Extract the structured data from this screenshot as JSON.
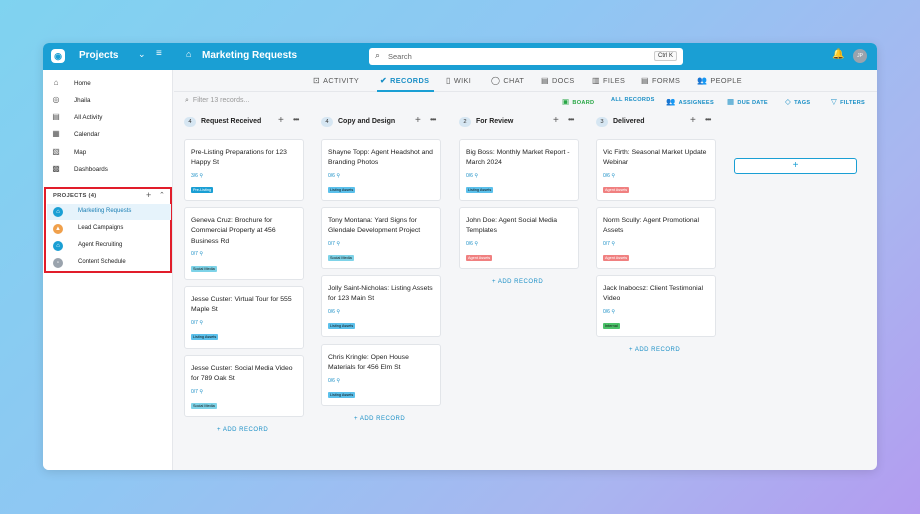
{
  "header": {
    "project_title": "Projects",
    "page_title": "Marketing Requests",
    "search_placeholder": "Search",
    "search_shortcut": "Ctrl K",
    "avatar_initials": "JP"
  },
  "sidebar": {
    "nav": [
      {
        "label": "Home",
        "icon": "home-icon"
      },
      {
        "label": "Jhaila",
        "icon": "check-circle-icon"
      },
      {
        "label": "All Activity",
        "icon": "activity-icon"
      },
      {
        "label": "Calendar",
        "icon": "calendar-icon"
      },
      {
        "label": "Map",
        "icon": "map-icon"
      },
      {
        "label": "Dashboards",
        "icon": "dashboard-icon"
      }
    ],
    "projects_header": "PROJECTS (4)",
    "projects": [
      {
        "label": "Marketing Requests",
        "color": "#1a9fd4",
        "active": true
      },
      {
        "label": "Lead Campaigns",
        "color": "#f0a04b"
      },
      {
        "label": "Agent Recruiting",
        "color": "#1a9fd4"
      },
      {
        "label": "Content Schedule",
        "color": "#9aa3ad"
      }
    ]
  },
  "tabs": [
    {
      "label": "ACTIVITY",
      "icon": "activity-icon"
    },
    {
      "label": "RECORDS",
      "icon": "check-circle-icon",
      "active": true
    },
    {
      "label": "WIKI",
      "icon": "document-icon"
    },
    {
      "label": "CHAT",
      "icon": "chat-icon"
    },
    {
      "label": "DOCS",
      "icon": "docs-icon"
    },
    {
      "label": "FILES",
      "icon": "files-icon"
    },
    {
      "label": "FORMS",
      "icon": "forms-icon"
    },
    {
      "label": "PEOPLE",
      "icon": "people-icon"
    }
  ],
  "toolbar": {
    "filter_placeholder": "Filter 13 records...",
    "board": "BOARD",
    "all_records": "ALL RECORDS",
    "assignees": "ASSIGNEES",
    "due_date": "DUE DATE",
    "tags": "TAGS",
    "filters": "FILTERS"
  },
  "add_record_label": "+ ADD RECORD",
  "colors": {
    "brand": "#1a9fd4",
    "tag_pre_listing": "#1a9fd4",
    "tag_listing_assets": "#5bc0eb",
    "tag_social_media": "#7ed3e8",
    "tag_agent_assets": "#f08080",
    "tag_internal": "#4cc26a"
  },
  "columns": [
    {
      "count": "4",
      "title": "Request Received",
      "cards": [
        {
          "title": "Pre-Listing Preparations for 123 Happy St",
          "progress": "3/6",
          "tag": "Pre-Listing",
          "tag_color": "#1a9fd4"
        },
        {
          "title": "Geneva Cruz: Brochure for Commercial Property at 456 Business Rd",
          "progress": "0/7",
          "tag": "Social Media",
          "tag_color": "#7ed3e8"
        },
        {
          "title": "Jesse Custer: Virtual Tour for 555 Maple St",
          "progress": "0/7",
          "tag": "Listing Assets",
          "tag_color": "#5bc0eb"
        },
        {
          "title": "Jesse Custer: Social Media Video for 789 Oak St",
          "progress": "0/7",
          "tag": "Social Media",
          "tag_color": "#7ed3e8"
        }
      ]
    },
    {
      "count": "4",
      "title": "Copy and Design",
      "cards": [
        {
          "title": "Shayne Topp: Agent Headshot and Branding Photos",
          "progress": "0/6",
          "tag": "Listing Assets",
          "tag_color": "#5bc0eb"
        },
        {
          "title": "Tony Montana: Yard Signs for Glendale Development Project",
          "progress": "0/7",
          "tag": "Social Media",
          "tag_color": "#7ed3e8"
        },
        {
          "title": "Jolly Saint-Nicholas: Listing Assets for 123 Main St",
          "progress": "0/6",
          "tag": "Listing Assets",
          "tag_color": "#5bc0eb"
        },
        {
          "title": "Chris Kringle: Open House Materials for 456 Elm St",
          "progress": "0/6",
          "tag": "Listing Assets",
          "tag_color": "#5bc0eb"
        }
      ]
    },
    {
      "count": "2",
      "title": "For Review",
      "cards": [
        {
          "title": "Big Boss: Monthly Market Report - March 2024",
          "progress": "0/6",
          "tag": "Listing Assets",
          "tag_color": "#5bc0eb"
        },
        {
          "title": "John Doe: Agent Social Media Templates",
          "progress": "0/6",
          "tag": "Agent Assets",
          "tag_color": "#f08080"
        }
      ]
    },
    {
      "count": "3",
      "title": "Delivered",
      "cards": [
        {
          "title": "Vic Firth: Seasonal Market Update Webinar",
          "progress": "0/6",
          "tag": "Agent Assets",
          "tag_color": "#f08080"
        },
        {
          "title": "Norm Scully: Agent Promotional Assets",
          "progress": "0/7",
          "tag": "Agent Assets",
          "tag_color": "#f08080"
        },
        {
          "title": "Jack Inabocsz: Client Testimonial Video",
          "progress": "0/6",
          "tag": "Internal",
          "tag_color": "#4cc26a"
        }
      ]
    }
  ]
}
